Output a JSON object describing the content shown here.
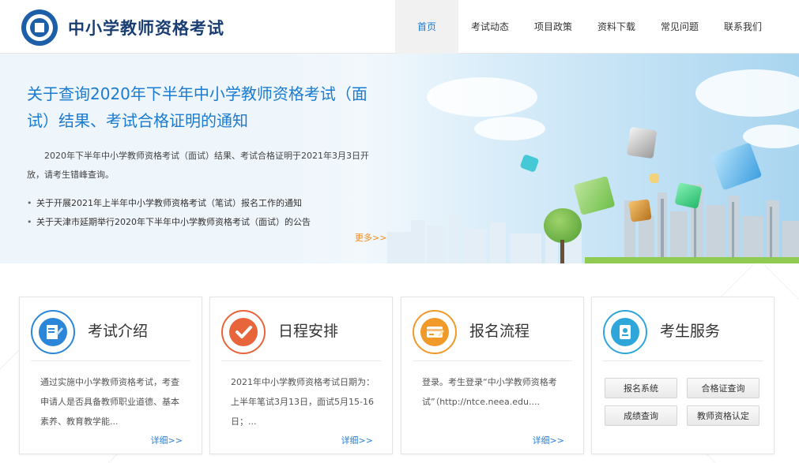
{
  "header": {
    "site_title": "中小学教师资格考试",
    "nav": [
      {
        "label": "首页",
        "active": true
      },
      {
        "label": "考试动态"
      },
      {
        "label": "项目政策"
      },
      {
        "label": "资料下载"
      },
      {
        "label": "常见问题"
      },
      {
        "label": "联系我们"
      }
    ]
  },
  "banner": {
    "headline": "关于查询2020年下半年中小学教师资格考试（面试）结果、考试合格证明的通知",
    "body": "2020年下半年中小学教师资格考试（面试）结果、考试合格证明于2021年3月3日开放，请考生错峰查询。",
    "news": [
      "关于开展2021年上半年中小学教师资格考试（笔试）报名工作的通知",
      "关于天津市延期举行2020年下半年中小学教师资格考试（面试）的公告"
    ],
    "more": "更多>>"
  },
  "cards": [
    {
      "title": "考试介绍",
      "desc": "通过实施中小学教师资格考试，考查申请人是否具备教师职业道德、基本素养、教育教学能...",
      "more": "详细>>",
      "icon": "edit-document-icon",
      "color": "#2b86d9"
    },
    {
      "title": "日程安排",
      "desc": "2021年中小学教师资格考试日期为：上半年笔试3月13日，面试5月15-16日；...",
      "more": "详细>>",
      "icon": "checkmark-icon",
      "color": "#e8653c"
    },
    {
      "title": "报名流程",
      "desc": "登录。考生登录“中小学教师资格考试”（http://ntce.neea.edu....",
      "more": "详细>>",
      "icon": "card-form-icon",
      "color": "#f09a2a"
    },
    {
      "title": "考生服务",
      "icon": "id-badge-icon",
      "color": "#2fa6d9",
      "buttons": [
        "报名系统",
        "合格证查询",
        "成绩查询",
        "教师资格认定"
      ]
    }
  ]
}
